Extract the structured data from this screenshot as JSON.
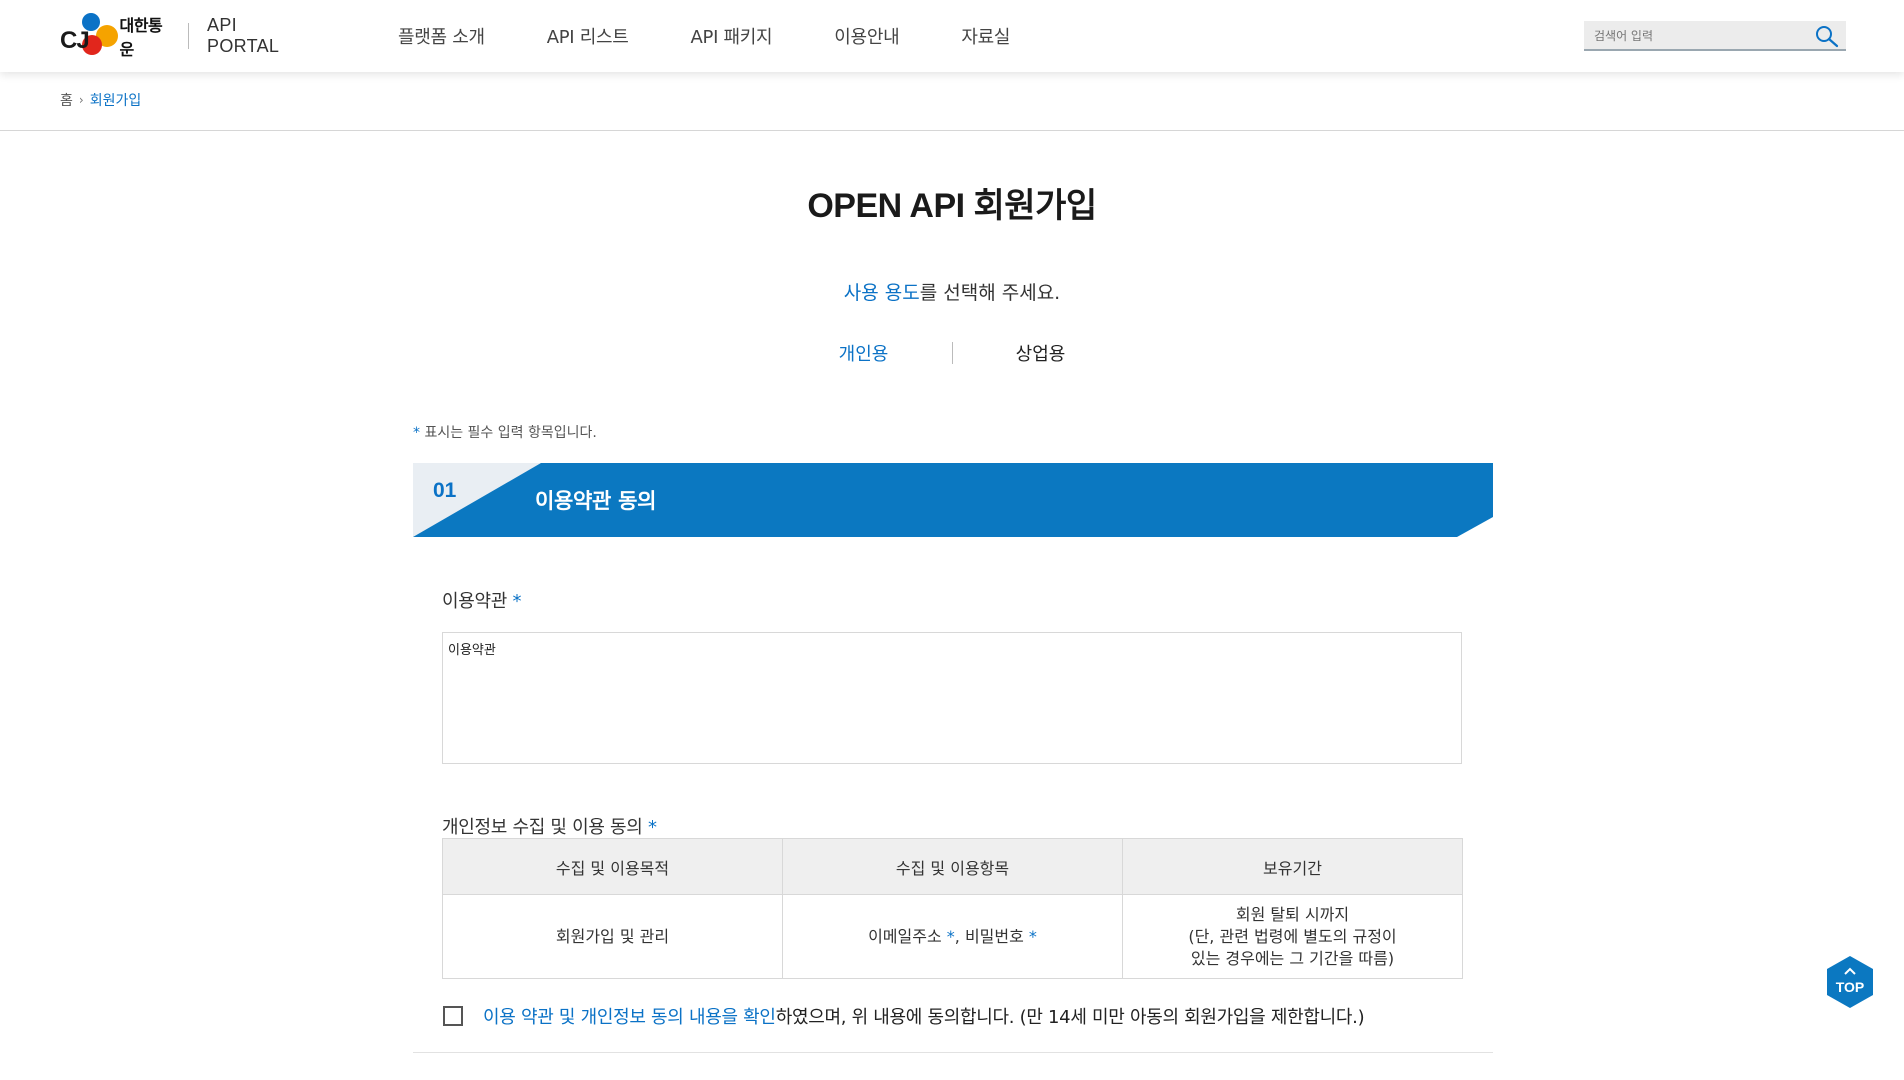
{
  "header": {
    "logo_company": "대한통운",
    "logo_brand": "CJ",
    "portal_name": "API PORTAL",
    "nav": [
      {
        "label": "플랫폼 소개"
      },
      {
        "label": "API 리스트"
      },
      {
        "label": "API 패키지"
      },
      {
        "label": "이용안내"
      },
      {
        "label": "자료실"
      }
    ],
    "search": {
      "placeholder": "검색어 입력",
      "value": ""
    }
  },
  "breadcrumb": {
    "home": "홈",
    "current": "회원가입"
  },
  "main": {
    "title": "OPEN API 회원가입",
    "usage_prompt_highlight": "사용 용도",
    "usage_prompt_rest": "를 선택해 주세요.",
    "usage_tabs": [
      {
        "label": "개인용",
        "active": true
      },
      {
        "label": "상업용",
        "active": false
      }
    ],
    "required_note_mark": "*",
    "required_note_text": " 표시는 필수 입력 항목입니다.",
    "section": {
      "number": "01",
      "title": "이용약관 동의"
    },
    "terms": {
      "label": "이용약관",
      "content": "이용약관"
    },
    "privacy": {
      "label": "개인정보 수집 및 이용 동의",
      "headers": [
        "수집 및 이용목적",
        "수집 및 이용항목",
        "보유기간"
      ],
      "purpose": "회원가입 및 관리",
      "item_email": "이메일주소",
      "item_password": "비밀번호",
      "item_sep": ", ",
      "retention": [
        "회원 탈퇴 시까지",
        "(단, 관련 법령에 별도의 규정이",
        "있는 경우에는 그 기간을 따름)"
      ]
    },
    "agree": {
      "link_text": "이용 약관 및 개인정보 동의 내용을 확인",
      "rest_text": "하였으며, 위 내용에 동의합니다. (만 14세 미만 아동의 회원가입을 제한합니다.)",
      "checked": false
    }
  },
  "top_button": {
    "label": "TOP"
  },
  "colors": {
    "accent": "#0b72c6",
    "section_banner": "#0b78c1",
    "header_bg": "#ffffff"
  }
}
